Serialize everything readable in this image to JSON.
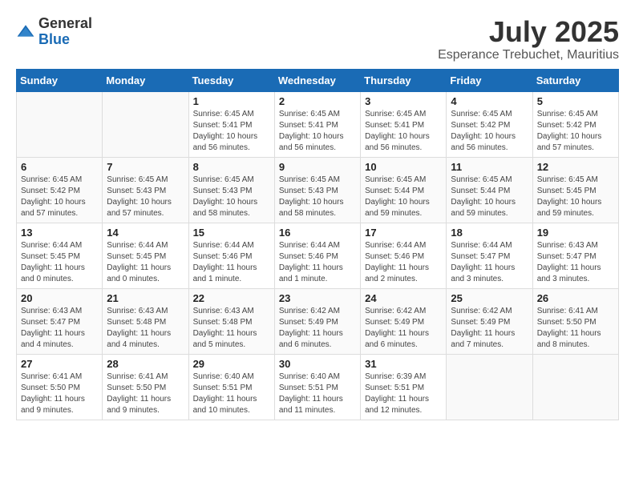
{
  "header": {
    "logo_general": "General",
    "logo_blue": "Blue",
    "month_title": "July 2025",
    "location": "Esperance Trebuchet, Mauritius"
  },
  "days_of_week": [
    "Sunday",
    "Monday",
    "Tuesday",
    "Wednesday",
    "Thursday",
    "Friday",
    "Saturday"
  ],
  "weeks": [
    [
      {
        "day": "",
        "sunrise": "",
        "sunset": "",
        "daylight": ""
      },
      {
        "day": "",
        "sunrise": "",
        "sunset": "",
        "daylight": ""
      },
      {
        "day": "1",
        "sunrise": "Sunrise: 6:45 AM",
        "sunset": "Sunset: 5:41 PM",
        "daylight": "Daylight: 10 hours and 56 minutes."
      },
      {
        "day": "2",
        "sunrise": "Sunrise: 6:45 AM",
        "sunset": "Sunset: 5:41 PM",
        "daylight": "Daylight: 10 hours and 56 minutes."
      },
      {
        "day": "3",
        "sunrise": "Sunrise: 6:45 AM",
        "sunset": "Sunset: 5:41 PM",
        "daylight": "Daylight: 10 hours and 56 minutes."
      },
      {
        "day": "4",
        "sunrise": "Sunrise: 6:45 AM",
        "sunset": "Sunset: 5:42 PM",
        "daylight": "Daylight: 10 hours and 56 minutes."
      },
      {
        "day": "5",
        "sunrise": "Sunrise: 6:45 AM",
        "sunset": "Sunset: 5:42 PM",
        "daylight": "Daylight: 10 hours and 57 minutes."
      }
    ],
    [
      {
        "day": "6",
        "sunrise": "Sunrise: 6:45 AM",
        "sunset": "Sunset: 5:42 PM",
        "daylight": "Daylight: 10 hours and 57 minutes."
      },
      {
        "day": "7",
        "sunrise": "Sunrise: 6:45 AM",
        "sunset": "Sunset: 5:43 PM",
        "daylight": "Daylight: 10 hours and 57 minutes."
      },
      {
        "day": "8",
        "sunrise": "Sunrise: 6:45 AM",
        "sunset": "Sunset: 5:43 PM",
        "daylight": "Daylight: 10 hours and 58 minutes."
      },
      {
        "day": "9",
        "sunrise": "Sunrise: 6:45 AM",
        "sunset": "Sunset: 5:43 PM",
        "daylight": "Daylight: 10 hours and 58 minutes."
      },
      {
        "day": "10",
        "sunrise": "Sunrise: 6:45 AM",
        "sunset": "Sunset: 5:44 PM",
        "daylight": "Daylight: 10 hours and 59 minutes."
      },
      {
        "day": "11",
        "sunrise": "Sunrise: 6:45 AM",
        "sunset": "Sunset: 5:44 PM",
        "daylight": "Daylight: 10 hours and 59 minutes."
      },
      {
        "day": "12",
        "sunrise": "Sunrise: 6:45 AM",
        "sunset": "Sunset: 5:45 PM",
        "daylight": "Daylight: 10 hours and 59 minutes."
      }
    ],
    [
      {
        "day": "13",
        "sunrise": "Sunrise: 6:44 AM",
        "sunset": "Sunset: 5:45 PM",
        "daylight": "Daylight: 11 hours and 0 minutes."
      },
      {
        "day": "14",
        "sunrise": "Sunrise: 6:44 AM",
        "sunset": "Sunset: 5:45 PM",
        "daylight": "Daylight: 11 hours and 0 minutes."
      },
      {
        "day": "15",
        "sunrise": "Sunrise: 6:44 AM",
        "sunset": "Sunset: 5:46 PM",
        "daylight": "Daylight: 11 hours and 1 minute."
      },
      {
        "day": "16",
        "sunrise": "Sunrise: 6:44 AM",
        "sunset": "Sunset: 5:46 PM",
        "daylight": "Daylight: 11 hours and 1 minute."
      },
      {
        "day": "17",
        "sunrise": "Sunrise: 6:44 AM",
        "sunset": "Sunset: 5:46 PM",
        "daylight": "Daylight: 11 hours and 2 minutes."
      },
      {
        "day": "18",
        "sunrise": "Sunrise: 6:44 AM",
        "sunset": "Sunset: 5:47 PM",
        "daylight": "Daylight: 11 hours and 3 minutes."
      },
      {
        "day": "19",
        "sunrise": "Sunrise: 6:43 AM",
        "sunset": "Sunset: 5:47 PM",
        "daylight": "Daylight: 11 hours and 3 minutes."
      }
    ],
    [
      {
        "day": "20",
        "sunrise": "Sunrise: 6:43 AM",
        "sunset": "Sunset: 5:47 PM",
        "daylight": "Daylight: 11 hours and 4 minutes."
      },
      {
        "day": "21",
        "sunrise": "Sunrise: 6:43 AM",
        "sunset": "Sunset: 5:48 PM",
        "daylight": "Daylight: 11 hours and 4 minutes."
      },
      {
        "day": "22",
        "sunrise": "Sunrise: 6:43 AM",
        "sunset": "Sunset: 5:48 PM",
        "daylight": "Daylight: 11 hours and 5 minutes."
      },
      {
        "day": "23",
        "sunrise": "Sunrise: 6:42 AM",
        "sunset": "Sunset: 5:49 PM",
        "daylight": "Daylight: 11 hours and 6 minutes."
      },
      {
        "day": "24",
        "sunrise": "Sunrise: 6:42 AM",
        "sunset": "Sunset: 5:49 PM",
        "daylight": "Daylight: 11 hours and 6 minutes."
      },
      {
        "day": "25",
        "sunrise": "Sunrise: 6:42 AM",
        "sunset": "Sunset: 5:49 PM",
        "daylight": "Daylight: 11 hours and 7 minutes."
      },
      {
        "day": "26",
        "sunrise": "Sunrise: 6:41 AM",
        "sunset": "Sunset: 5:50 PM",
        "daylight": "Daylight: 11 hours and 8 minutes."
      }
    ],
    [
      {
        "day": "27",
        "sunrise": "Sunrise: 6:41 AM",
        "sunset": "Sunset: 5:50 PM",
        "daylight": "Daylight: 11 hours and 9 minutes."
      },
      {
        "day": "28",
        "sunrise": "Sunrise: 6:41 AM",
        "sunset": "Sunset: 5:50 PM",
        "daylight": "Daylight: 11 hours and 9 minutes."
      },
      {
        "day": "29",
        "sunrise": "Sunrise: 6:40 AM",
        "sunset": "Sunset: 5:51 PM",
        "daylight": "Daylight: 11 hours and 10 minutes."
      },
      {
        "day": "30",
        "sunrise": "Sunrise: 6:40 AM",
        "sunset": "Sunset: 5:51 PM",
        "daylight": "Daylight: 11 hours and 11 minutes."
      },
      {
        "day": "31",
        "sunrise": "Sunrise: 6:39 AM",
        "sunset": "Sunset: 5:51 PM",
        "daylight": "Daylight: 11 hours and 12 minutes."
      },
      {
        "day": "",
        "sunrise": "",
        "sunset": "",
        "daylight": ""
      },
      {
        "day": "",
        "sunrise": "",
        "sunset": "",
        "daylight": ""
      }
    ]
  ]
}
